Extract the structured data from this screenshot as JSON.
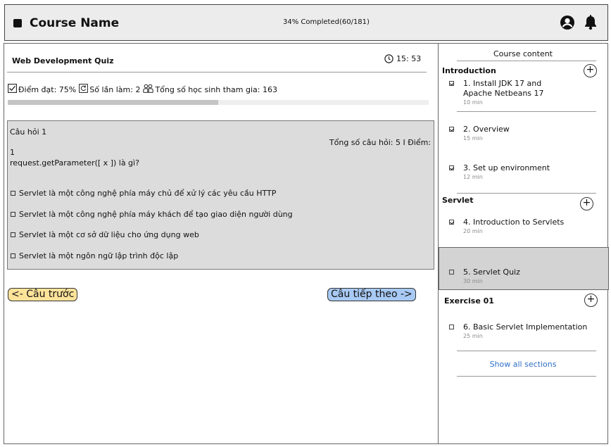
{
  "header": {
    "course_name": "Course Name",
    "progress_text": "34% Completed(60/181)",
    "user_icon": "user-circle-icon",
    "bell_icon": "bell-icon"
  },
  "quiz": {
    "title": "Web Development Quiz",
    "timer": "15: 53",
    "score_label": "Điểm đạt: 75%",
    "attempts_label": "Số lần làm: 2",
    "participants_label": "Tổng số học sinh tham gia: 163",
    "progress_fraction": 0.5,
    "question_number": "Câu hỏi 1",
    "question_total": "Tổng số câu hỏi: 5 I Điểm:",
    "question_point": "1",
    "question_text": "request.getParameter([ x ]) là gì?",
    "options": [
      "Servlet là một công nghệ phía máy chủ để xử lý các yêu cầu HTTP",
      "Servlet là một công nghệ phía máy khách để tạo giao diện người dùng",
      "Servlet là một cơ sở dữ liệu cho ứng dụng web",
      "Servlet là một ngôn ngữ lập trình độc lập"
    ],
    "prev_label": "<- Câu trước",
    "next_label": "Câu tiếp theo ->",
    "prev_color": "#fde39a",
    "next_color": "#a8c9f3"
  },
  "sidebar": {
    "title": "Course content",
    "sections": [
      {
        "title": "Introduction",
        "lessons": [
          {
            "name": "1. Install JDK 17 and Apache Netbeans 17",
            "duration": "10 min",
            "done": true
          },
          {
            "name": "2. Overview",
            "duration": "15 min",
            "done": true
          },
          {
            "name": "3. Set up environment",
            "duration": "12 min",
            "done": true
          }
        ]
      },
      {
        "title": "Servlet",
        "lessons": [
          {
            "name": "4. Introduction to Servlets",
            "duration": "20 min",
            "done": true
          },
          {
            "name": "5. Servlet Quiz",
            "duration": "30 min",
            "done": false,
            "active": true
          }
        ]
      },
      {
        "title": "Exercise 01",
        "lessons": [
          {
            "name": "6. Basic Servlet Implementation",
            "duration": "25 min",
            "done": false
          }
        ]
      }
    ],
    "show_all": "Show all sections"
  }
}
